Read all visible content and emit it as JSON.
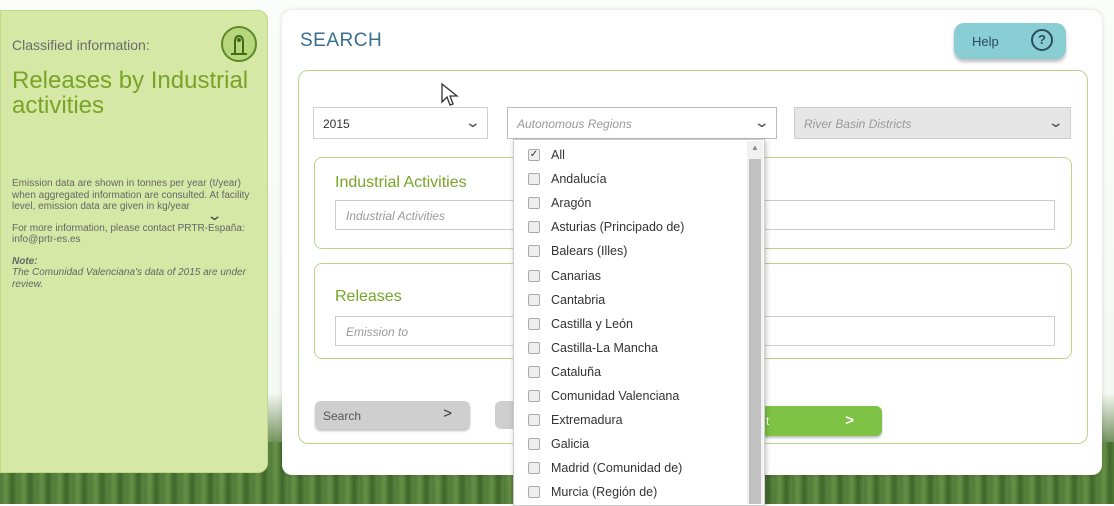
{
  "left": {
    "classified_label": "Classified information:",
    "title": "Releases by Industrial activities",
    "info": "Emission data are shown in tonnes per year (t/year) when aggregated information are consulted. At facility level, emission data are given in kg/year",
    "contact": "For more information, please contact PRTR-España: info@prtr-es.es",
    "note_label": "Note:",
    "note_text": "The Comunidad Valenciana's data of 2015 are under review."
  },
  "main": {
    "title": "SEARCH",
    "help_label": "Help",
    "help_icon_glyph": "?",
    "year_value": "2015",
    "regions_placeholder": "Autonomous Regions",
    "basin_placeholder": "River Basin Districts",
    "industrial_title": "Industrial Activities",
    "industrial_placeholder": "Industrial Activities",
    "releases_title": "Releases",
    "emission_placeholder": "Emission to",
    "search_button": "Search",
    "search_arrow": ">",
    "green_button_text": "t",
    "green_arrow": ">"
  },
  "dropdown": {
    "items": [
      {
        "label": "All",
        "checked": true
      },
      {
        "label": "Andalucía",
        "checked": false
      },
      {
        "label": "Aragón",
        "checked": false
      },
      {
        "label": "Asturias (Principado de)",
        "checked": false
      },
      {
        "label": "Balears (Illes)",
        "checked": false
      },
      {
        "label": "Canarias",
        "checked": false
      },
      {
        "label": "Cantabria",
        "checked": false
      },
      {
        "label": "Castilla y León",
        "checked": false
      },
      {
        "label": "Castilla-La Mancha",
        "checked": false
      },
      {
        "label": "Cataluña",
        "checked": false
      },
      {
        "label": "Comunidad Valenciana",
        "checked": false
      },
      {
        "label": "Extremadura",
        "checked": false
      },
      {
        "label": "Galicia",
        "checked": false
      },
      {
        "label": "Madrid (Comunidad de)",
        "checked": false
      },
      {
        "label": "Murcia (Región de)",
        "checked": false
      }
    ]
  },
  "colors": {
    "panel_green": "#d6e8a6",
    "title_green": "#79a427",
    "search_blue": "#3a6f8e",
    "help_bg": "#89cdd5",
    "button_green": "#7fc346"
  },
  "icons": {
    "classified": "plant-icon",
    "help": "help-icon",
    "chevron": "chevron-down-icon",
    "cursor": "mouse-cursor-icon"
  }
}
